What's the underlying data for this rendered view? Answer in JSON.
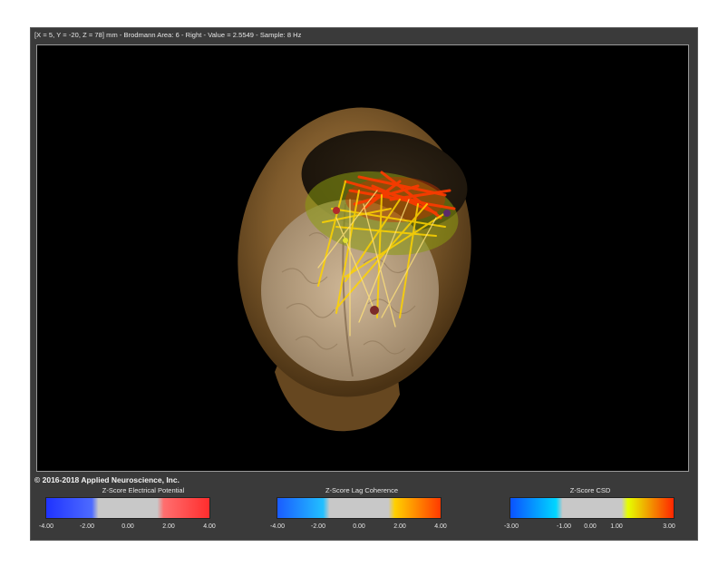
{
  "status_bar": {
    "text": "[X = 5, Y = -20, Z = 78] mm - Brodmann Area: 6 - Right - Value = 2.5549 - Sample: 8 Hz"
  },
  "copyright": "© 2016-2018 Applied Neuroscience, Inc.",
  "colorbars": [
    {
      "title": "Z-Score Electrical Potential",
      "ticks": [
        "-4.00",
        "-2.00",
        "0.00",
        "2.00",
        "4.00"
      ],
      "colors": [
        "#1f33ff",
        "#4d6bff",
        "#c8c8c8",
        "#c8c8c8",
        "#ff6f6f",
        "#ff2d2d"
      ]
    },
    {
      "title": "Z-Score Lag Coherence",
      "ticks": [
        "-4.00",
        "-2.00",
        "0.00",
        "2.00",
        "4.00"
      ],
      "colors": [
        "#1a5cff",
        "#22c0ff",
        "#c8c8c8",
        "#c8c8c8",
        "#ffd000",
        "#ff3a00"
      ]
    },
    {
      "title": "Z-Score CSD",
      "ticks": [
        "-3.00",
        "-1.00",
        "0.00",
        "1.00",
        "3.00"
      ],
      "colors": [
        "#0b52ff",
        "#00d6ff",
        "#c8c8c8",
        "#c8c8c8",
        "#e6ff00",
        "#ff2600"
      ]
    }
  ]
}
